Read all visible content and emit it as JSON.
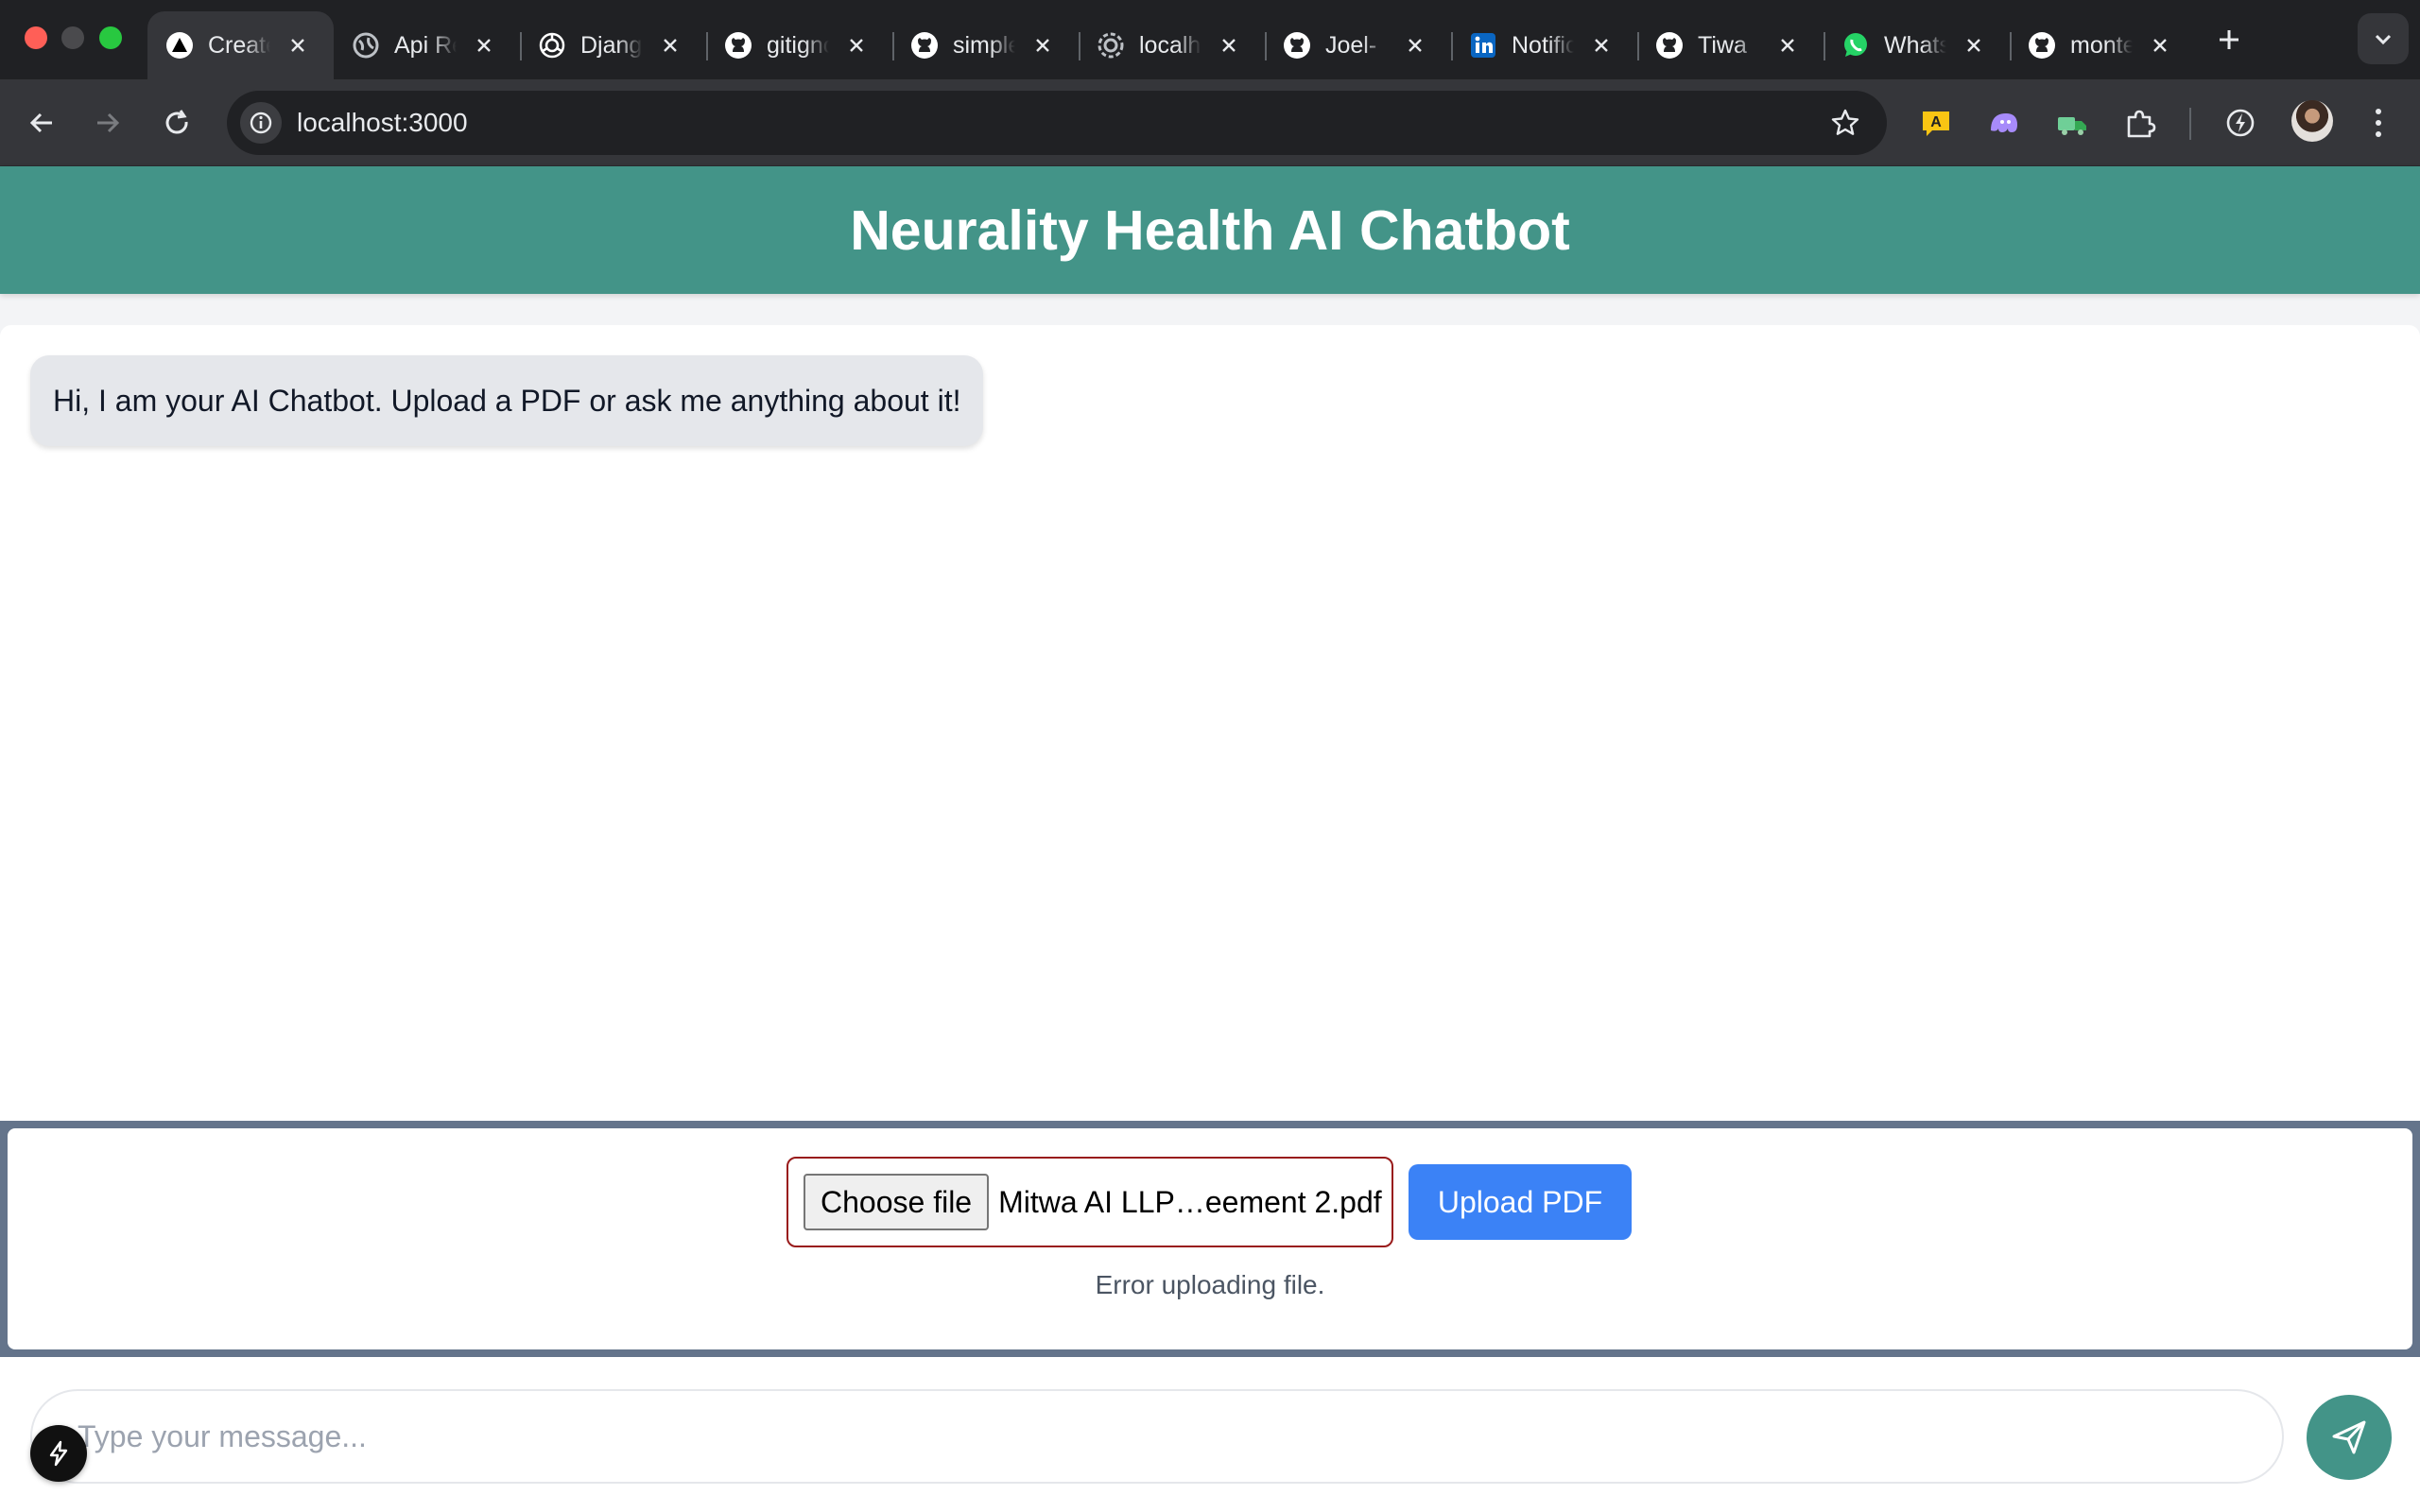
{
  "browser": {
    "tabs": [
      {
        "title": "Create Next App",
        "icon": "nextjs-icon",
        "active": true
      },
      {
        "title": "Api Reference",
        "icon": "globe-icon",
        "active": false
      },
      {
        "title": "Django",
        "icon": "openai-icon",
        "active": false
      },
      {
        "title": "gitignore",
        "icon": "github-icon",
        "active": false
      },
      {
        "title": "simple",
        "icon": "github-icon",
        "active": false
      },
      {
        "title": "localhost",
        "icon": "globe-icon",
        "active": false
      },
      {
        "title": "Joel-",
        "icon": "github-icon",
        "active": false
      },
      {
        "title": "Notifications",
        "icon": "linkedin-icon",
        "active": false
      },
      {
        "title": "Tiwa",
        "icon": "github-icon",
        "active": false
      },
      {
        "title": "WhatsApp",
        "icon": "whatsapp-icon",
        "active": false
      },
      {
        "title": "monte",
        "icon": "github-icon",
        "active": false
      }
    ],
    "url": "localhost:3000",
    "colors": {
      "tabstrip": "#202124",
      "toolbar": "#35363a"
    }
  },
  "app": {
    "title": "Neurality Health AI Chatbot",
    "messages": [
      {
        "role": "bot",
        "text": "Hi, I am your AI Chatbot. Upload a PDF or ask me anything about it!"
      }
    ],
    "upload": {
      "choose_label": "Choose file",
      "file_name": "Mitwa AI LLP…eement 2.pdf",
      "button_label": "Upload PDF",
      "status": "Error uploading file."
    },
    "input": {
      "placeholder": "Type your message..."
    },
    "colors": {
      "header": "#439488",
      "upload_button": "#3b82f6",
      "error_border": "#991b1b",
      "send_button": "#439488"
    }
  }
}
